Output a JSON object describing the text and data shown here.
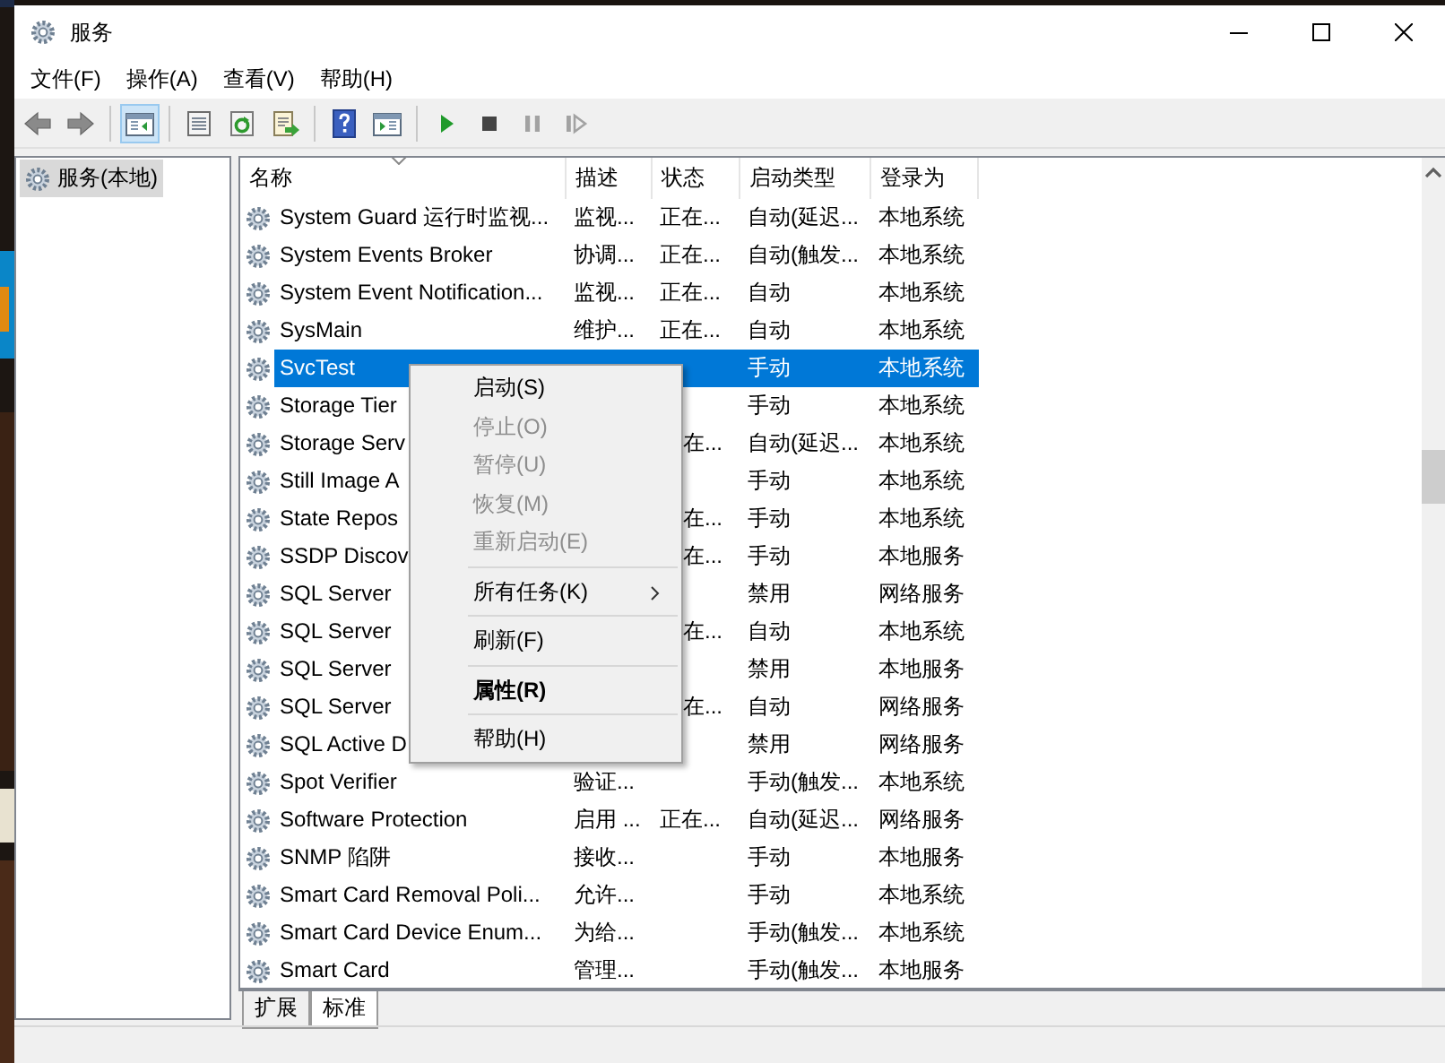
{
  "window": {
    "title": "服务"
  },
  "menu": [
    "文件(F)",
    "操作(A)",
    "查看(V)",
    "帮助(H)"
  ],
  "toolbar": [
    {
      "kind": "back",
      "disabled": false,
      "pressed": false
    },
    {
      "kind": "forward",
      "disabled": false,
      "pressed": false
    },
    {
      "kind": "sep"
    },
    {
      "kind": "tree",
      "disabled": false,
      "pressed": true
    },
    {
      "kind": "sep"
    },
    {
      "kind": "properties",
      "disabled": false,
      "pressed": false
    },
    {
      "kind": "refresh",
      "disabled": false,
      "pressed": false
    },
    {
      "kind": "export",
      "disabled": false,
      "pressed": false
    },
    {
      "kind": "sep"
    },
    {
      "kind": "help",
      "disabled": false,
      "pressed": false
    },
    {
      "kind": "pane",
      "disabled": false,
      "pressed": false
    },
    {
      "kind": "sep"
    },
    {
      "kind": "play",
      "disabled": false,
      "pressed": false
    },
    {
      "kind": "stop",
      "disabled": false,
      "pressed": false
    },
    {
      "kind": "pause",
      "disabled": true,
      "pressed": false
    },
    {
      "kind": "resume",
      "disabled": true,
      "pressed": false
    }
  ],
  "tree": [
    {
      "label": "服务(本地)",
      "selected": true
    }
  ],
  "table": {
    "columns": [
      "名称",
      "描述",
      "状态",
      "启动类型",
      "登录为"
    ],
    "rows": [
      {
        "name": "System Guard 运行时监视...",
        "description": "监视...",
        "status": "正在...",
        "status_partly_hidden": false,
        "startup_type": "自动(延迟...",
        "log_on_as": "本地系统",
        "selected": false
      },
      {
        "name": "System Events Broker",
        "description": "协调...",
        "status": "正在...",
        "status_partly_hidden": false,
        "startup_type": "自动(触发...",
        "log_on_as": "本地系统",
        "selected": false
      },
      {
        "name": "System Event Notification...",
        "description": "监视...",
        "status": "正在...",
        "status_partly_hidden": false,
        "startup_type": "自动",
        "log_on_as": "本地系统",
        "selected": false
      },
      {
        "name": "SysMain",
        "description": "维护...",
        "status": "正在...",
        "status_partly_hidden": false,
        "startup_type": "自动",
        "log_on_as": "本地系统",
        "selected": false
      },
      {
        "name": "SvcTest",
        "startup_type": "手动",
        "log_on_as": "本地系统",
        "selected": true
      },
      {
        "name": "Storage Tier",
        "startup_type": "手动",
        "log_on_as": "本地系统",
        "selected": false
      },
      {
        "name": "Storage Serv",
        "status": "在...",
        "status_partly_hidden": true,
        "startup_type": "自动(延迟...",
        "log_on_as": "本地系统",
        "selected": false
      },
      {
        "name": "Still Image A",
        "startup_type": "手动",
        "log_on_as": "本地系统",
        "selected": false
      },
      {
        "name": "State Repos",
        "status": "在...",
        "status_partly_hidden": true,
        "startup_type": "手动",
        "log_on_as": "本地系统",
        "selected": false
      },
      {
        "name": "SSDP Discov",
        "status": "在...",
        "status_partly_hidden": true,
        "startup_type": "手动",
        "log_on_as": "本地服务",
        "selected": false
      },
      {
        "name": "SQL Server",
        "startup_type": "禁用",
        "log_on_as": "网络服务",
        "selected": false
      },
      {
        "name": "SQL Server",
        "status": "在...",
        "status_partly_hidden": true,
        "startup_type": "自动",
        "log_on_as": "本地系统",
        "selected": false
      },
      {
        "name": "SQL Server",
        "startup_type": "禁用",
        "log_on_as": "本地服务",
        "selected": false
      },
      {
        "name": "SQL Server",
        "status": "在...",
        "status_partly_hidden": true,
        "startup_type": "自动",
        "log_on_as": "网络服务",
        "selected": false
      },
      {
        "name": "SQL Active D",
        "startup_type": "禁用",
        "log_on_as": "网络服务",
        "selected": false
      },
      {
        "name": "Spot Verifier",
        "description": "验证...",
        "startup_type": "手动(触发...",
        "log_on_as": "本地系统",
        "selected": false
      },
      {
        "name": "Software Protection",
        "description": "启用 ...",
        "status": "正在...",
        "status_partly_hidden": false,
        "startup_type": "自动(延迟...",
        "log_on_as": "网络服务",
        "selected": false
      },
      {
        "name": "SNMP 陷阱",
        "description": "接收...",
        "startup_type": "手动",
        "log_on_as": "本地服务",
        "selected": false
      },
      {
        "name": "Smart Card Removal Poli...",
        "description": "允许...",
        "startup_type": "手动",
        "log_on_as": "本地系统",
        "selected": false
      },
      {
        "name": "Smart Card Device Enum...",
        "description": "为给...",
        "startup_type": "手动(触发...",
        "log_on_as": "本地系统",
        "selected": false
      },
      {
        "name": "Smart Card",
        "description": "管理...",
        "startup_type": "手动(触发...",
        "log_on_as": "本地服务",
        "selected": false
      }
    ]
  },
  "tabs": [
    {
      "label": "扩展",
      "selected": false
    },
    {
      "label": "标准",
      "selected": true
    }
  ],
  "context_menu": {
    "items": [
      {
        "kind": "item",
        "label": "启动(S)",
        "disabled": false,
        "default": false,
        "submenu": false
      },
      {
        "kind": "item",
        "label": "停止(O)",
        "disabled": true,
        "default": false,
        "submenu": false
      },
      {
        "kind": "item",
        "label": "暂停(U)",
        "disabled": true,
        "default": false,
        "submenu": false
      },
      {
        "kind": "item",
        "label": "恢复(M)",
        "disabled": true,
        "default": false,
        "submenu": false
      },
      {
        "kind": "item",
        "label": "重新启动(E)",
        "disabled": true,
        "default": false,
        "submenu": false
      },
      {
        "kind": "separator"
      },
      {
        "kind": "item",
        "label": "所有任务(K)",
        "disabled": false,
        "default": false,
        "submenu": true
      },
      {
        "kind": "separator"
      },
      {
        "kind": "item",
        "label": "刷新(F)",
        "disabled": false,
        "default": false,
        "submenu": false
      },
      {
        "kind": "separator"
      },
      {
        "kind": "item",
        "label": "属性(R)",
        "disabled": false,
        "default": true,
        "submenu": false
      },
      {
        "kind": "separator"
      },
      {
        "kind": "item",
        "label": "帮助(H)",
        "disabled": false,
        "default": false,
        "submenu": false
      }
    ]
  }
}
